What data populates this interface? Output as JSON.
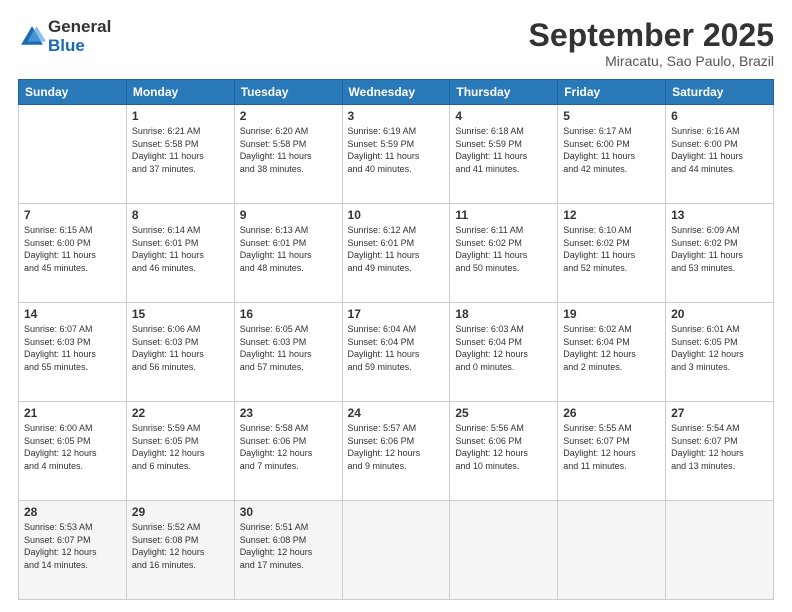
{
  "header": {
    "logo_general": "General",
    "logo_blue": "Blue",
    "month": "September 2025",
    "location": "Miracatu, Sao Paulo, Brazil"
  },
  "weekdays": [
    "Sunday",
    "Monday",
    "Tuesday",
    "Wednesday",
    "Thursday",
    "Friday",
    "Saturday"
  ],
  "weeks": [
    [
      {
        "day": "",
        "info": ""
      },
      {
        "day": "1",
        "info": "Sunrise: 6:21 AM\nSunset: 5:58 PM\nDaylight: 11 hours\nand 37 minutes."
      },
      {
        "day": "2",
        "info": "Sunrise: 6:20 AM\nSunset: 5:58 PM\nDaylight: 11 hours\nand 38 minutes."
      },
      {
        "day": "3",
        "info": "Sunrise: 6:19 AM\nSunset: 5:59 PM\nDaylight: 11 hours\nand 40 minutes."
      },
      {
        "day": "4",
        "info": "Sunrise: 6:18 AM\nSunset: 5:59 PM\nDaylight: 11 hours\nand 41 minutes."
      },
      {
        "day": "5",
        "info": "Sunrise: 6:17 AM\nSunset: 6:00 PM\nDaylight: 11 hours\nand 42 minutes."
      },
      {
        "day": "6",
        "info": "Sunrise: 6:16 AM\nSunset: 6:00 PM\nDaylight: 11 hours\nand 44 minutes."
      }
    ],
    [
      {
        "day": "7",
        "info": "Sunrise: 6:15 AM\nSunset: 6:00 PM\nDaylight: 11 hours\nand 45 minutes."
      },
      {
        "day": "8",
        "info": "Sunrise: 6:14 AM\nSunset: 6:01 PM\nDaylight: 11 hours\nand 46 minutes."
      },
      {
        "day": "9",
        "info": "Sunrise: 6:13 AM\nSunset: 6:01 PM\nDaylight: 11 hours\nand 48 minutes."
      },
      {
        "day": "10",
        "info": "Sunrise: 6:12 AM\nSunset: 6:01 PM\nDaylight: 11 hours\nand 49 minutes."
      },
      {
        "day": "11",
        "info": "Sunrise: 6:11 AM\nSunset: 6:02 PM\nDaylight: 11 hours\nand 50 minutes."
      },
      {
        "day": "12",
        "info": "Sunrise: 6:10 AM\nSunset: 6:02 PM\nDaylight: 11 hours\nand 52 minutes."
      },
      {
        "day": "13",
        "info": "Sunrise: 6:09 AM\nSunset: 6:02 PM\nDaylight: 11 hours\nand 53 minutes."
      }
    ],
    [
      {
        "day": "14",
        "info": "Sunrise: 6:07 AM\nSunset: 6:03 PM\nDaylight: 11 hours\nand 55 minutes."
      },
      {
        "day": "15",
        "info": "Sunrise: 6:06 AM\nSunset: 6:03 PM\nDaylight: 11 hours\nand 56 minutes."
      },
      {
        "day": "16",
        "info": "Sunrise: 6:05 AM\nSunset: 6:03 PM\nDaylight: 11 hours\nand 57 minutes."
      },
      {
        "day": "17",
        "info": "Sunrise: 6:04 AM\nSunset: 6:04 PM\nDaylight: 11 hours\nand 59 minutes."
      },
      {
        "day": "18",
        "info": "Sunrise: 6:03 AM\nSunset: 6:04 PM\nDaylight: 12 hours\nand 0 minutes."
      },
      {
        "day": "19",
        "info": "Sunrise: 6:02 AM\nSunset: 6:04 PM\nDaylight: 12 hours\nand 2 minutes."
      },
      {
        "day": "20",
        "info": "Sunrise: 6:01 AM\nSunset: 6:05 PM\nDaylight: 12 hours\nand 3 minutes."
      }
    ],
    [
      {
        "day": "21",
        "info": "Sunrise: 6:00 AM\nSunset: 6:05 PM\nDaylight: 12 hours\nand 4 minutes."
      },
      {
        "day": "22",
        "info": "Sunrise: 5:59 AM\nSunset: 6:05 PM\nDaylight: 12 hours\nand 6 minutes."
      },
      {
        "day": "23",
        "info": "Sunrise: 5:58 AM\nSunset: 6:06 PM\nDaylight: 12 hours\nand 7 minutes."
      },
      {
        "day": "24",
        "info": "Sunrise: 5:57 AM\nSunset: 6:06 PM\nDaylight: 12 hours\nand 9 minutes."
      },
      {
        "day": "25",
        "info": "Sunrise: 5:56 AM\nSunset: 6:06 PM\nDaylight: 12 hours\nand 10 minutes."
      },
      {
        "day": "26",
        "info": "Sunrise: 5:55 AM\nSunset: 6:07 PM\nDaylight: 12 hours\nand 11 minutes."
      },
      {
        "day": "27",
        "info": "Sunrise: 5:54 AM\nSunset: 6:07 PM\nDaylight: 12 hours\nand 13 minutes."
      }
    ],
    [
      {
        "day": "28",
        "info": "Sunrise: 5:53 AM\nSunset: 6:07 PM\nDaylight: 12 hours\nand 14 minutes."
      },
      {
        "day": "29",
        "info": "Sunrise: 5:52 AM\nSunset: 6:08 PM\nDaylight: 12 hours\nand 16 minutes."
      },
      {
        "day": "30",
        "info": "Sunrise: 5:51 AM\nSunset: 6:08 PM\nDaylight: 12 hours\nand 17 minutes."
      },
      {
        "day": "",
        "info": ""
      },
      {
        "day": "",
        "info": ""
      },
      {
        "day": "",
        "info": ""
      },
      {
        "day": "",
        "info": ""
      }
    ]
  ]
}
